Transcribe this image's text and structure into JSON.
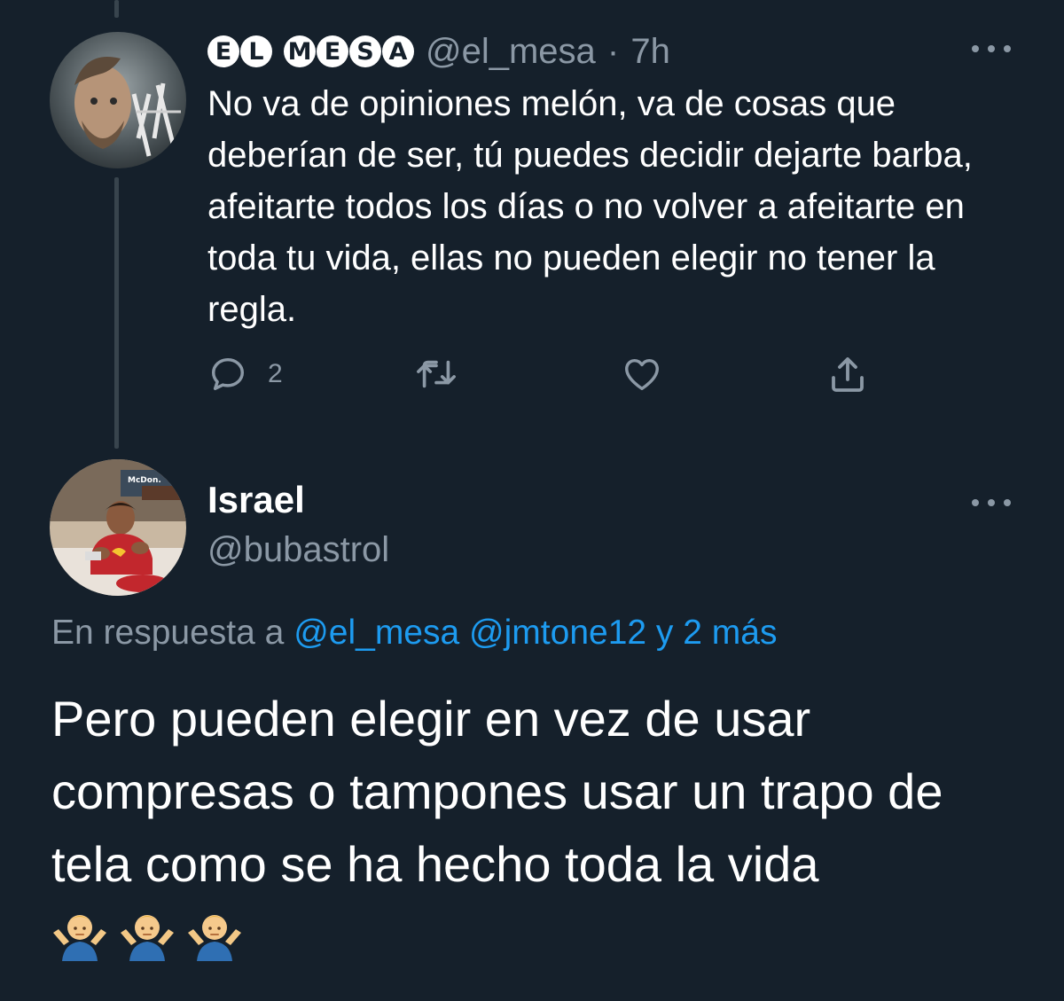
{
  "tweet1": {
    "display_name_letters": [
      "E",
      "L",
      "M",
      "E",
      "S",
      "A"
    ],
    "handle": "@el_mesa",
    "separator": "·",
    "time": "7h",
    "text": "No va de opiniones melón, va de cosas que deberían de ser, tú puedes decidir dejarte barba, afeitarte todos los días o no volver a afeitarte en toda tu vida, ellas no pueden elegir no tener la regla.",
    "reply_count": "2",
    "avatar_icon": "avatar-photo"
  },
  "tweet2": {
    "display_name": "Israel",
    "handle": "@bubastrol",
    "reply_prefix": "En respuesta a",
    "mention_1": "@el_mesa",
    "mention_2": "@jmtone12",
    "mention_more": "y 2 más",
    "text": "Pero pueden elegir en vez de usar compresas o tampones usar un trapo de tela como se ha hecho toda la vida",
    "emoji": [
      "man-shrugging",
      "man-shrugging",
      "man-shrugging"
    ]
  },
  "colors": {
    "background": "#15202b",
    "secondary_text": "#8b98a5",
    "accent": "#1d9bf0",
    "thread_line": "#38444d"
  },
  "icons": {
    "reply": "reply-icon",
    "retweet": "retweet-icon",
    "like": "like-icon",
    "share": "share-icon",
    "more": "more-icon"
  }
}
